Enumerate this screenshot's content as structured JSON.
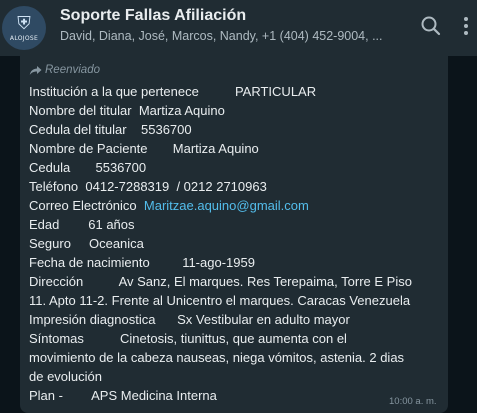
{
  "header": {
    "avatar_text": "ALOJOSE",
    "title": "Soporte Fallas Afiliación",
    "members": "David, Diana, José, Marcos, Nandy, +1 (404) 452-9004, ..."
  },
  "message": {
    "forwarded_label": "Reenviado",
    "lines": [
      "Institución a la que pertenece          PARTICULAR",
      "Nombre del titular  Martiza Aquino",
      "Cedula del titular    5536700",
      "Nombre de Paciente       Martiza Aquino",
      "Cedula       5536700",
      "Teléfono  0412-7288319  / 0212 2710963",
      "Correo Electrónico  ",
      "Edad        61 años",
      "Seguro     Oceanica",
      "Fecha de nacimiento         11-ago-1959",
      "Dirección          Av Sanz, El marques. Res Terepaima, Torre E Piso",
      "11. Apto 11-2. Frente al Unicentro el marques. Caracas Venezuela",
      "Impresión diagnostica      Sx Vestibular en adulto mayor",
      "Síntomas          Cinetosis, tiunittus, que aumenta con el",
      "movimiento de la cabeza nauseas, niega vómitos, astenia. 2 dias",
      "de evolución",
      "Plan -        APS Medicina Interna"
    ],
    "email": "Maritzae.aquino@gmail.com",
    "time": "10:00 a. m."
  },
  "icons": {
    "search": "search-icon",
    "menu": "more-vertical-icon",
    "forward": "forward-arrow-icon"
  },
  "colors": {
    "header_bg": "#202c33",
    "bubble_bg": "#202c33",
    "chat_bg": "#0b141a",
    "text": "#e9edef",
    "muted": "#8696a0",
    "link": "#53bdeb"
  }
}
